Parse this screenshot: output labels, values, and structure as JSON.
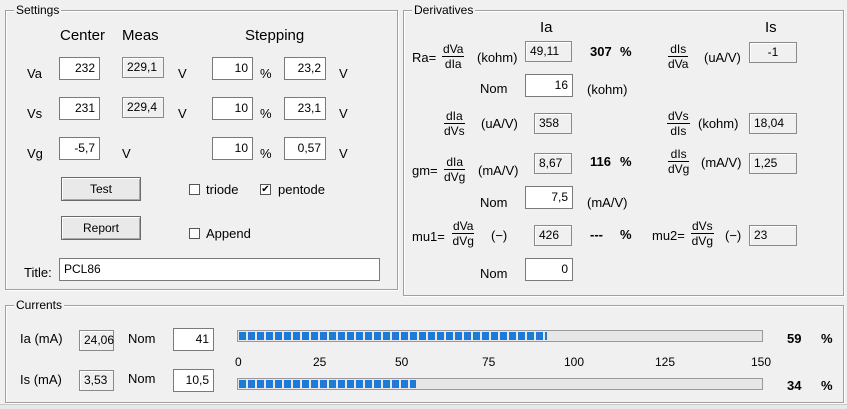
{
  "settings": {
    "title": "Settings",
    "col_center": "Center",
    "col_meas": "Meas",
    "col_stepping": "Stepping",
    "rows": [
      {
        "label": "Va",
        "center": "232",
        "meas": "229,1",
        "unit1": "V",
        "step": "10",
        "pct": "%",
        "step_v": "23,2",
        "unit2": "V"
      },
      {
        "label": "Vs",
        "center": "231",
        "meas": "229,4",
        "unit1": "V",
        "step": "10",
        "pct": "%",
        "step_v": "23,1",
        "unit2": "V"
      },
      {
        "label": "Vg",
        "center": "-5,7",
        "unit1": "V",
        "step": "10",
        "pct": "%",
        "step_v": "0,57",
        "unit2": "V"
      }
    ],
    "test_button": "Test",
    "report_button": "Report",
    "triode_label": "triode",
    "triode_checked": false,
    "pentode_label": "pentode",
    "pentode_checked": true,
    "append_label": "Append",
    "append_checked": false,
    "title_label": "Title:",
    "title_value": "PCL86"
  },
  "derivatives": {
    "title": "Derivatives",
    "ia_header": "Ia",
    "is_header": "Is",
    "ra_label": "Ra=",
    "ra_frac": {
      "num": "dVa",
      "den": "dIa"
    },
    "ra_unit": "(kohm)",
    "ra_value": "49,11",
    "ra_pct_value": "307",
    "ra_pct_sign": "%",
    "ra_nom_label": "Nom",
    "ra_nom_value": "16",
    "ra_nom_unit": "(kohm)",
    "dis_dva_frac": {
      "num": "dIs",
      "den": "dVa"
    },
    "dis_dva_unit": "(uA/V)",
    "dis_dva_value": "-1",
    "dia_dvs_frac": {
      "num": "dIa",
      "den": "dVs"
    },
    "dia_dvs_unit": "(uA/V)",
    "dia_dvs_value": "358",
    "dvs_dis_frac": {
      "num": "dVs",
      "den": "dIs"
    },
    "dvs_dis_unit": "(kohm)",
    "dvs_dis_value": "18,04",
    "gm_label": "gm=",
    "gm_frac": {
      "num": "dIa",
      "den": "dVg"
    },
    "gm_unit": "(mA/V)",
    "gm_value": "8,67",
    "gm_pct_value": "116",
    "gm_pct_sign": "%",
    "gm_nom_label": "Nom",
    "gm_nom_value": "7,5",
    "gm_nom_unit": "(mA/V)",
    "dis_dvg_frac": {
      "num": "dIs",
      "den": "dVg"
    },
    "dis_dvg_unit": "(mA/V)",
    "dis_dvg_value": "1,25",
    "mu1_label": "mu1=",
    "mu1_frac": {
      "num": "dVa",
      "den": "dVg"
    },
    "mu1_unit": "(−)",
    "mu1_value": "426",
    "mu1_pct_value": "---",
    "mu1_pct_sign": "%",
    "mu1_nom_label": "Nom",
    "mu1_nom_value": "0",
    "mu2_label": "mu2=",
    "mu2_frac": {
      "num": "dVs",
      "den": "dVg"
    },
    "mu2_unit": "(−)",
    "mu2_value": "23"
  },
  "currents": {
    "title": "Currents",
    "ia_label": "Ia (mA)",
    "ia_value": "24,06",
    "ia_nom_label": "Nom",
    "ia_nom_value": "41",
    "ia_percent": "59",
    "ia_percent_sign": "%",
    "ia_bar_fraction": 0.59,
    "is_label": "Is (mA)",
    "is_value": "3,53",
    "is_nom_label": "Nom",
    "is_nom_value": "10,5",
    "is_percent": "34",
    "is_percent_sign": "%",
    "is_bar_fraction": 0.34,
    "scale_ticks": [
      "0",
      "25",
      "50",
      "75",
      "100",
      "125",
      "150"
    ],
    "bar_color": "#1e7ad6"
  }
}
